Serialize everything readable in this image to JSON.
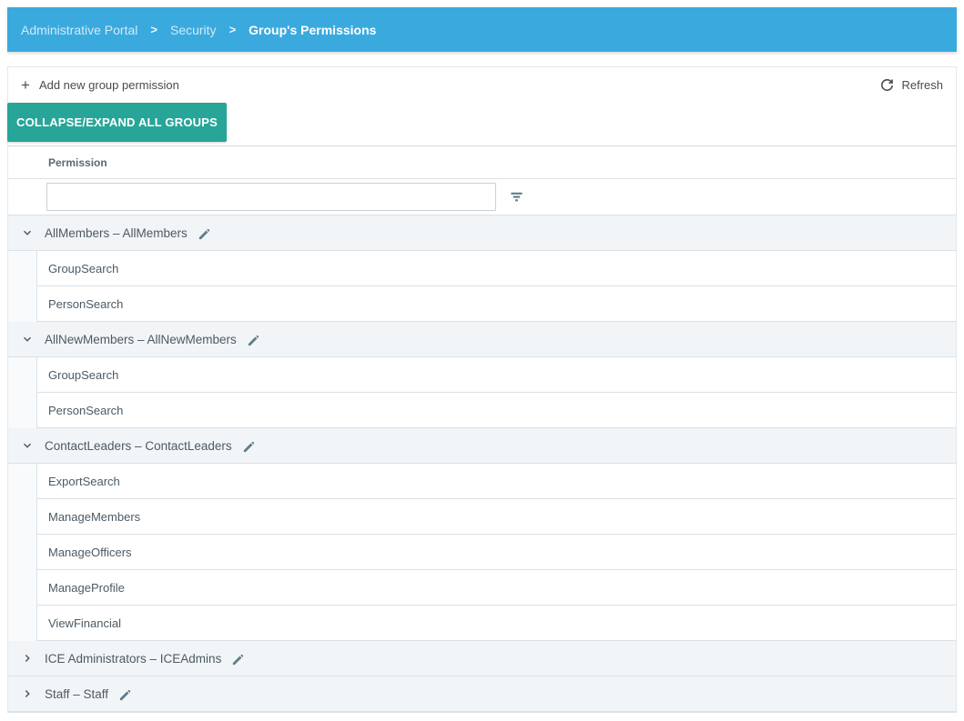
{
  "breadcrumb": {
    "items": [
      {
        "label": "Administrative Portal"
      },
      {
        "label": "Security"
      },
      {
        "label": "Group's Permissions"
      }
    ],
    "separator": ">"
  },
  "toolbar": {
    "add_label": "Add new group permission",
    "refresh_label": "Refresh",
    "collapse_button_label": "COLLAPSE/EXPAND ALL GROUPS"
  },
  "table": {
    "column_header": "Permission",
    "filter_value": ""
  },
  "groups": [
    {
      "label": "AllMembers – AllMembers",
      "expanded": true,
      "permissions": [
        "GroupSearch",
        "PersonSearch"
      ]
    },
    {
      "label": "AllNewMembers – AllNewMembers",
      "expanded": true,
      "permissions": [
        "GroupSearch",
        "PersonSearch"
      ]
    },
    {
      "label": "ContactLeaders – ContactLeaders",
      "expanded": true,
      "permissions": [
        "ExportSearch",
        "ManageMembers",
        "ManageOfficers",
        "ManageProfile",
        "ViewFinancial"
      ]
    },
    {
      "label": "ICE Administrators – ICEAdmins",
      "expanded": false,
      "permissions": []
    },
    {
      "label": "Staff – Staff",
      "expanded": false,
      "permissions": []
    }
  ],
  "icons": {
    "plus": "+",
    "refresh": "circular-arrow",
    "filter": "three-bar-funnel",
    "edit": "pencil",
    "expand": "chevron-down",
    "collapse": "chevron-right"
  },
  "colors": {
    "header_bg": "#3aaade",
    "accent_teal": "#27a598",
    "border": "#dbe1e6",
    "group_header_bg": "#f2f5f7",
    "icon_slate": "#607d8b",
    "text": "#4c5a64"
  }
}
